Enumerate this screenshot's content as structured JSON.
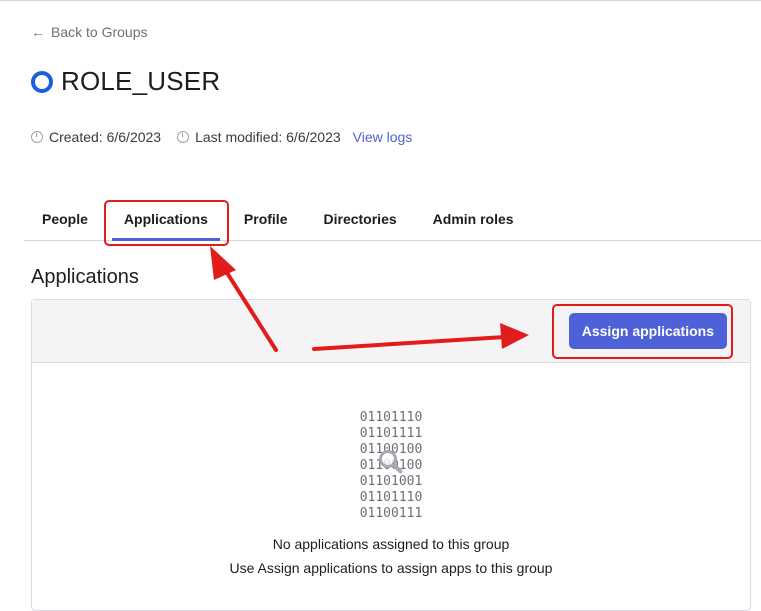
{
  "nav": {
    "back_label": "Back to Groups"
  },
  "group": {
    "name": "ROLE_USER",
    "created": "Created: 6/6/2023",
    "last_modified": "Last modified: 6/6/2023",
    "view_logs": "View logs"
  },
  "tabs": [
    {
      "label": "People"
    },
    {
      "label": "Applications",
      "active": true
    },
    {
      "label": "Profile"
    },
    {
      "label": "Directories"
    },
    {
      "label": "Admin roles"
    }
  ],
  "section": {
    "title": "Applications",
    "assign_button": "Assign applications",
    "binary_lines": [
      "01101110",
      "01101111",
      "01100100",
      "01100100",
      "01101001",
      "01101110",
      "01100111"
    ],
    "empty_primary": "No applications assigned to this group",
    "empty_secondary": "Use Assign applications to assign apps to this group"
  },
  "colors": {
    "accent": "#4f61d6",
    "status_ring": "#1662dd",
    "annotation": "#e21b1b"
  },
  "icons": {
    "back": "arrow-left-icon",
    "status": "ring-icon",
    "meta": "clock-icon",
    "empty": "magnifier-icon"
  }
}
